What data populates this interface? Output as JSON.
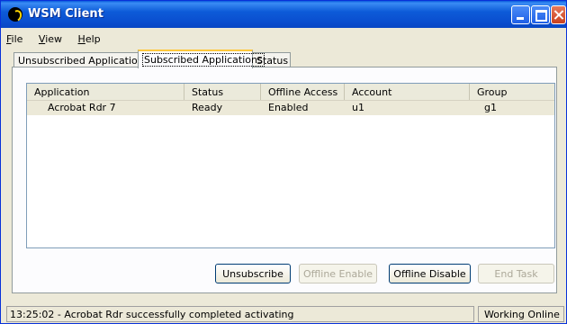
{
  "window": {
    "title": "WSM Client",
    "icon": "wsm-logo-icon"
  },
  "menu": [
    {
      "label": "File",
      "mnemonic": "F",
      "rest": "ile"
    },
    {
      "label": "View",
      "mnemonic": "V",
      "rest": "iew"
    },
    {
      "label": "Help",
      "mnemonic": "H",
      "rest": "elp"
    }
  ],
  "tabs": [
    {
      "label": "Unsubscribed Applications"
    },
    {
      "label": "Subscribed Applications",
      "active": true
    },
    {
      "label": "Status"
    }
  ],
  "list": {
    "columns": [
      "Application",
      "Status",
      "Offline Access",
      "Account",
      "Group"
    ],
    "rows": [
      {
        "application": "Acrobat Rdr 7",
        "status": "Ready",
        "offline_access": "Enabled",
        "account": "u1",
        "group": "g1"
      }
    ]
  },
  "buttons": {
    "unsubscribe": "Unsubscribe",
    "offline_enable": "Offline Enable",
    "offline_disable": "Offline Disable",
    "end_task": "End Task"
  },
  "statusbar": {
    "message": "13:25:02 - Acrobat Rdr successfully completed activating",
    "connection": "Working Online"
  },
  "colors": {
    "titlebar": "#0a4fd0",
    "tab_highlight": "#ffc83c",
    "selected_row": "#ece9d8"
  }
}
